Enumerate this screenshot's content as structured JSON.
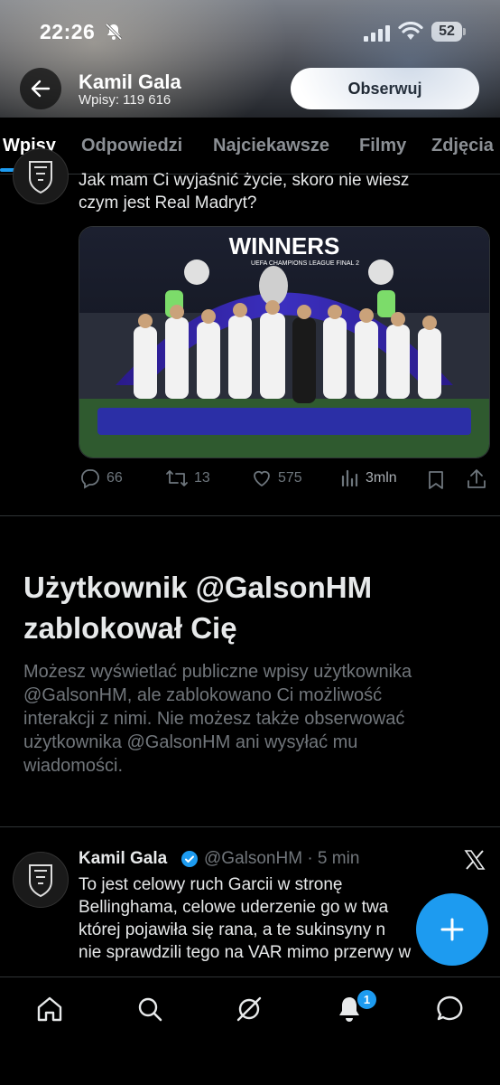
{
  "status_bar": {
    "time": "22:26",
    "battery": "52"
  },
  "header": {
    "profile_name": "Kamil Gala",
    "posts_count": "Wpisy: 119 616",
    "follow_label": "Obserwuj"
  },
  "tabs": [
    {
      "label": "Wpisy",
      "active": true
    },
    {
      "label": "Odpowiedzi",
      "active": false
    },
    {
      "label": "Najciekawsze",
      "active": false
    },
    {
      "label": "Filmy",
      "active": false
    },
    {
      "label": "Zdjęcia",
      "active": false
    }
  ],
  "tweet1": {
    "text_line1": "Jak mam Ci wyjaśnić życie, skoro nie wiesz",
    "text_line2": "czym jest Real Madryt?",
    "image_banner": "WINNERS",
    "image_banner_sub": "UEFA CHAMPIONS LEAGUE FINAL 2",
    "replies": "66",
    "reposts": "13",
    "likes": "575",
    "views": "3mln"
  },
  "blocked": {
    "title_line1": "Użytkownik @GalsonHM",
    "title_line2": "zablokował Cię",
    "desc_line1": "Możesz wyświetlać publiczne wpisy użytkownika",
    "desc_line2": "@GalsonHM, ale zablokowano Ci możliwość",
    "desc_line3": "interakcji z nimi. Nie możesz także obserwować",
    "desc_line4": "użytkownika @GalsonHM ani wysyłać mu",
    "desc_line5": "wiadomości."
  },
  "tweet2": {
    "name": "Kamil Gala",
    "handle_time": "@GalsonHM · 5 min",
    "line1": "To jest celowy ruch Garcii w stronę",
    "line2": "Bellinghama, celowe uderzenie go w twa",
    "line3": "której pojawiła się rana, a te sukinsyny n",
    "line4": "nie sprawdzili tego na VAR mimo przerwy w"
  },
  "bottom_nav": {
    "items": [
      "home-icon",
      "search-icon",
      "grok-icon",
      "notifications-icon",
      "messages-icon"
    ],
    "notification_badge": "1"
  },
  "colors": {
    "accent": "#1d9bf0",
    "background": "#000000",
    "text_primary": "#e7e9ea",
    "text_secondary": "#71767b"
  }
}
